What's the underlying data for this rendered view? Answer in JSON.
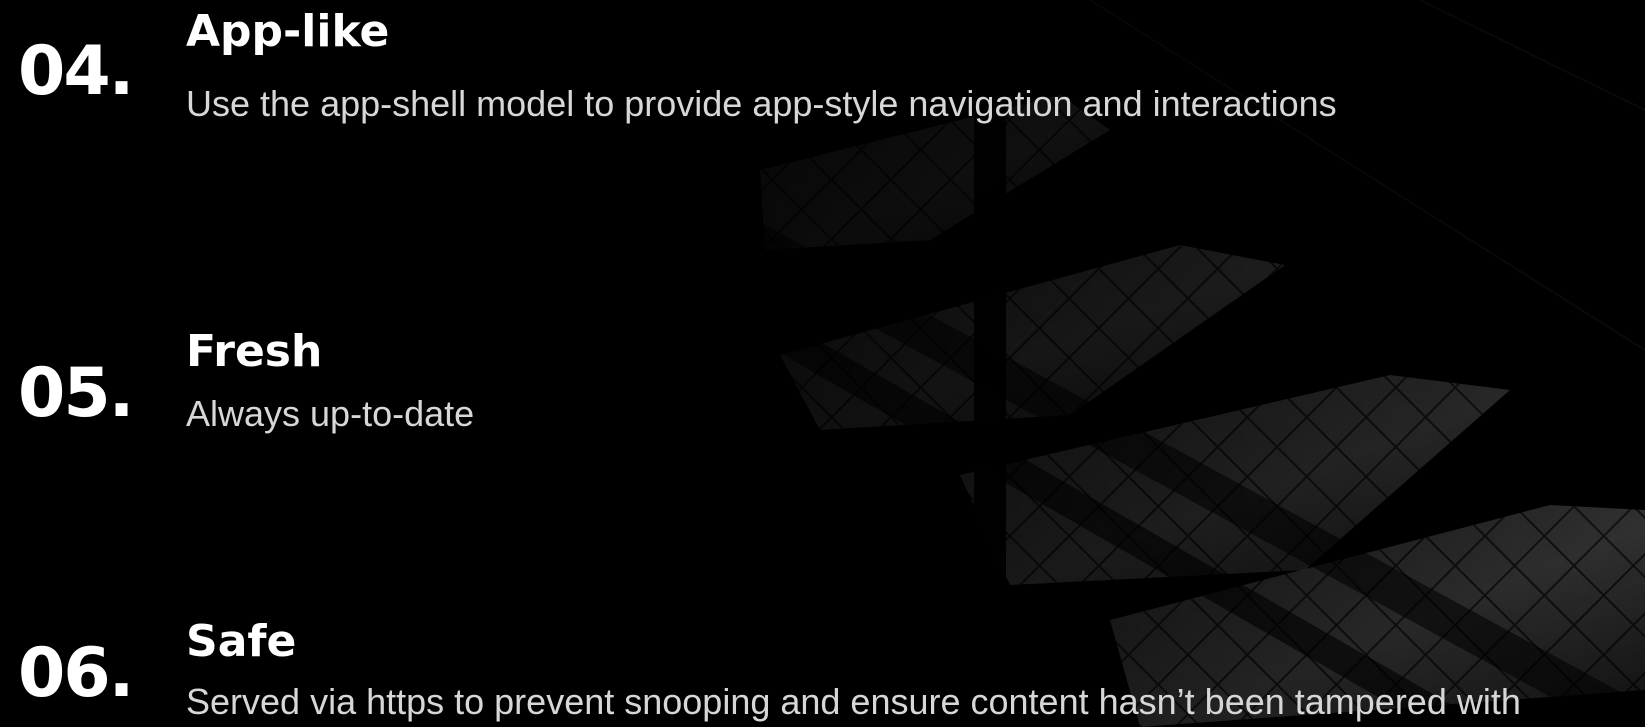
{
  "features": [
    {
      "number": "04.",
      "title": "App-like",
      "description": "Use the app-shell model to provide app-style navigation and interactions"
    },
    {
      "number": "05.",
      "title": "Fresh",
      "description": "Always up-to-date"
    },
    {
      "number": "06.",
      "title": "Safe",
      "description": "Served via https to prevent snooping and ensure content hasn’t been tampered with"
    }
  ],
  "colors": {
    "background": "#000000",
    "heading": "#ffffff",
    "description": "#d7d7d7",
    "background_image_highlight": "#8a8a8a"
  }
}
